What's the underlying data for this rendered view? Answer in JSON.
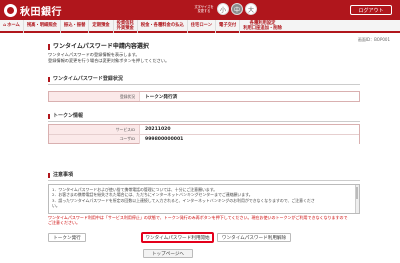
{
  "header": {
    "bank_name": "秋田銀行",
    "fontsize_label": "文字サイズを変更する",
    "fontsize_buttons": [
      "小",
      "中",
      "大"
    ],
    "logout_label": "ログアウト"
  },
  "nav": {
    "items": [
      "ホーム",
      "残高・明細照会",
      "振込・振替",
      "定期預金",
      "投資信託",
      "外貨預金",
      "税金・各種料金の払込",
      "住宅ローン",
      "電子交付",
      "各種利用設定",
      "利用口座追加・削除"
    ]
  },
  "screen_id": "画面ID：BOP001",
  "page": {
    "title": "ワンタイムパスワード申請内容選択",
    "desc_line1": "ワンタイムパスワードの登録情報を表示します。",
    "desc_line2": "登録情報の変更を行う場合は変更対象ボタンを押してください。"
  },
  "registration": {
    "title": "ワンタイムパスワード登録状況",
    "label": "登録状況",
    "value": "トークン発行済"
  },
  "token": {
    "title": "トークン情報",
    "rows": [
      {
        "label": "サービスID",
        "value": "20211020"
      },
      {
        "label": "ユーザID",
        "value": "999800000001"
      }
    ]
  },
  "notice": {
    "title": "注意事項",
    "lines": [
      "1．ワンタイムパスワードおよび使い捨て携帯電話の管理については、十分にご注意願います。",
      "2．お客さまの携帯電話を紛失された場合には、ただちにインターネットバンキングセンターまでご連絡願います。",
      "3．誤ったワンタイムパスワードを所定の回数以上連続して入力されると、インターネットバンキングのお利用ができなくなりますので、ご注意くださ",
      "い。"
    ]
  },
  "warning": {
    "line1": "ワンタイムパスワード利用中は「サービス利用停止」の状態で、トークン発行のみ再ボタンを押下してください。現在お使いのトークンがご利用できなくなりますので",
    "line2": "ご注意ください。"
  },
  "buttons": {
    "token_issue": "トークン発行",
    "otp_start": "ワンタイムパスワード利用開始",
    "otp_cancel": "ワンタイムパスワード利用解除",
    "top_page": "トップページへ"
  }
}
